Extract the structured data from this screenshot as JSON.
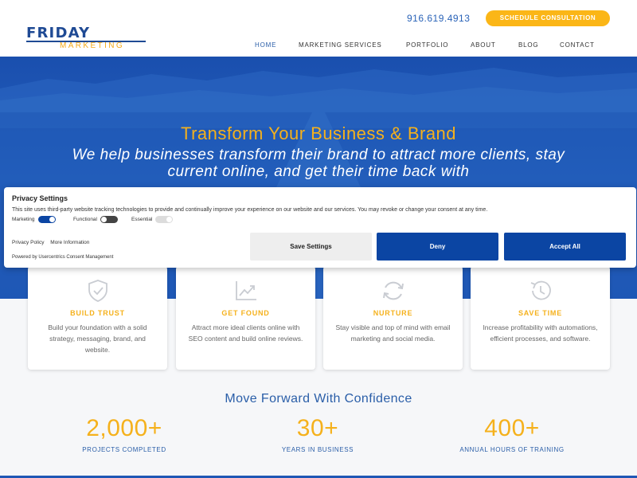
{
  "brand": {
    "logo_main": "FRIDAY",
    "logo_sub": "MARKETING",
    "colors": {
      "blue": "#1f57b5",
      "gold": "#f5b11c",
      "deep_blue": "#0b45a3"
    }
  },
  "header": {
    "phone": "916.619.4913",
    "cta": "SCHEDULE CONSULTATION",
    "nav": [
      "HOME",
      "MARKETING SERVICES",
      "PORTFOLIO",
      "ABOUT",
      "BLOG",
      "CONTACT"
    ],
    "active_nav": "HOME"
  },
  "hero": {
    "title": "Transform Your Business & Brand",
    "subtitle": "We help businesses transform their brand to attract more clients, stay current online, and get their time back with"
  },
  "cards": [
    {
      "icon": "shield-check-icon",
      "title": "BUILD TRUST",
      "text": "Build your foundation with a solid strategy, messaging, brand, and website."
    },
    {
      "icon": "chart-trend-icon",
      "title": "GET FOUND",
      "text": "Attract more ideal clients online with SEO content and build online reviews."
    },
    {
      "icon": "refresh-icon",
      "title": "NURTURE",
      "text": "Stay visible and top of mind with email marketing and social media."
    },
    {
      "icon": "history-clock-icon",
      "title": "SAVE TIME",
      "text": "Increase profitability with automations, efficient processes, and software."
    }
  ],
  "stats": {
    "title": "Move Forward With Confidence",
    "items": [
      {
        "value": "2,000+",
        "label": "PROJECTS COMPLETED"
      },
      {
        "value": "30+",
        "label": "YEARS IN BUSINESS"
      },
      {
        "value": "400+",
        "label": "ANNUAL HOURS OF TRAINING"
      }
    ]
  },
  "consent": {
    "title": "Privacy Settings",
    "description": "This site uses third-party website tracking technologies to provide and continually improve your experience on our website and our services. You may revoke or change your consent at any time.",
    "toggles": [
      {
        "label": "Marketing",
        "state": "on"
      },
      {
        "label": "Functional",
        "state": "off"
      },
      {
        "label": "Essential",
        "state": "disabled"
      }
    ],
    "privacy_policy": "Privacy Policy",
    "more_info": "More Information",
    "powered_by": "Powered by Usercentrics Consent Management",
    "save_label": "Save Settings",
    "deny_label": "Deny",
    "accept_label": "Accept All"
  }
}
